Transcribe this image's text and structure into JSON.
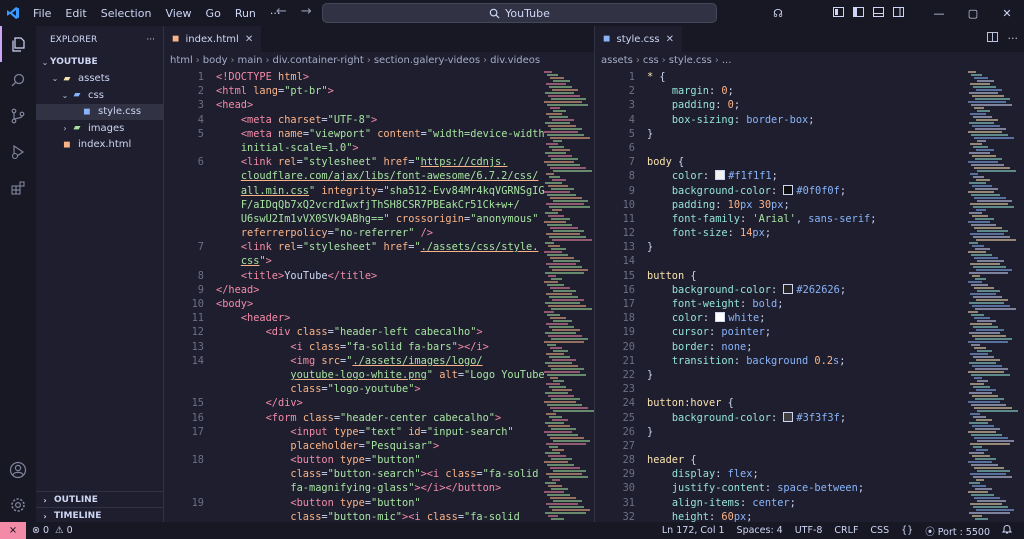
{
  "titlebar": {
    "menu": [
      "File",
      "Edit",
      "Selection",
      "View",
      "Go",
      "Run"
    ],
    "more": "···",
    "back": "←",
    "forward": "→",
    "search": "YouTube",
    "copilot": "☊",
    "window_controls": [
      "—",
      "▢",
      "✕"
    ]
  },
  "activity": {
    "items": [
      {
        "name": "explorer-icon",
        "glyph": "❐"
      },
      {
        "name": "search-icon",
        "glyph": "⌕"
      },
      {
        "name": "source-control-icon",
        "glyph": "⑂"
      },
      {
        "name": "run-debug-icon",
        "glyph": "▷"
      },
      {
        "name": "extensions-icon",
        "glyph": "⊞"
      }
    ],
    "account": "◯",
    "settings": "⚙"
  },
  "explorer": {
    "title": "EXPLORER",
    "more": "···",
    "tree": [
      {
        "label": "YOUTUBE",
        "depth": 0,
        "chev": "⌄",
        "icon": "",
        "bold": true
      },
      {
        "label": "assets",
        "depth": 1,
        "chev": "⌄",
        "icon": "▰",
        "color": "#f9e2af"
      },
      {
        "label": "css",
        "depth": 2,
        "chev": "⌄",
        "icon": "▰",
        "color": "#89b4fa"
      },
      {
        "label": "style.css",
        "depth": 3,
        "chev": "",
        "icon": "◼",
        "color": "#89b4fa",
        "selected": true
      },
      {
        "label": "images",
        "depth": 2,
        "chev": "›",
        "icon": "▰",
        "color": "#a6e3a1"
      },
      {
        "label": "index.html",
        "depth": 1,
        "chev": "",
        "icon": "◼",
        "color": "#fab387"
      }
    ],
    "outline": "OUTLINE",
    "timeline": "TIMELINE"
  },
  "left_editor": {
    "tab": "index.html",
    "breadcrumb": [
      "html",
      "body",
      "main",
      "div.container-right",
      "section.galery-videos",
      "div.videos"
    ],
    "lines": [
      {
        "n": "1",
        "h": "<span class='tg'>&lt;!DOCTYPE</span> <span class='at'>html</span><span class='tg'>&gt;</span>"
      },
      {
        "n": "2",
        "h": "<span class='tg'>&lt;html</span> <span class='at'>lang</span><span class='pu'>=</span><span class='sv'>\"pt-br\"</span><span class='tg'>&gt;</span>"
      },
      {
        "n": "3",
        "h": "<span class='tg'>&lt;head&gt;</span>"
      },
      {
        "n": "4",
        "h": "    <span class='tg'>&lt;meta</span> <span class='at'>charset</span><span class='pu'>=</span><span class='sv'>\"UTF-8\"</span><span class='tg'>&gt;</span>"
      },
      {
        "n": "5",
        "h": "    <span class='tg'>&lt;meta</span> <span class='at'>name</span><span class='pu'>=</span><span class='sv'>\"viewport\"</span> <span class='at'>content</span><span class='pu'>=</span><span class='sv'>\"width=device-width,</span>"
      },
      {
        "n": "",
        "h": "    <span class='sv'>initial-scale=1.0\"</span><span class='tg'>&gt;</span>"
      },
      {
        "n": "6",
        "h": "    <span class='tg'>&lt;link</span> <span class='at'>rel</span><span class='pu'>=</span><span class='sv'>\"stylesheet\"</span> <span class='at'>href</span><span class='pu'>=</span><span class='sv'>\"</span><span class='lk'>https://cdnjs.</span>"
      },
      {
        "n": "",
        "h": "    <span class='lk'>cloudflare.com/ajax/libs/font-awesome/6.7.2/css/</span>"
      },
      {
        "n": "",
        "h": "    <span class='lk'>all.min.css</span><span class='sv'>\"</span> <span class='at'>integrity</span><span class='pu'>=</span><span class='sv'>\"sha512-Evv84Mr4kqVGRNSgIGL/</span>"
      },
      {
        "n": "",
        "h": "    <span class='sv'>F/aIDqQb7xQ2vcrdIwxfjThSH8CSR7PBEakCr51Ck+w+/</span>"
      },
      {
        "n": "",
        "h": "    <span class='sv'>U6swU2Im1vVX0SVk9ABhg==\"</span> <span class='at'>crossorigin</span><span class='pu'>=</span><span class='sv'>\"anonymous\"</span>"
      },
      {
        "n": "",
        "h": "    <span class='at'>referrerpolicy</span><span class='pu'>=</span><span class='sv'>\"no-referrer\"</span> <span class='tg'>/&gt;</span>"
      },
      {
        "n": "7",
        "h": "    <span class='tg'>&lt;link</span> <span class='at'>rel</span><span class='pu'>=</span><span class='sv'>\"stylesheet\"</span> <span class='at'>href</span><span class='pu'>=</span><span class='sv'>\"</span><span class='lk'>./assets/css/style.</span>"
      },
      {
        "n": "",
        "h": "    <span class='lk'>css</span><span class='sv'>\"</span><span class='tg'>&gt;</span>"
      },
      {
        "n": "8",
        "h": "    <span class='tg'>&lt;title&gt;</span><span class='pl'>YouTube</span><span class='tg'>&lt;/title&gt;</span>"
      },
      {
        "n": "9",
        "h": "<span class='tg'>&lt;/head&gt;</span>"
      },
      {
        "n": "10",
        "h": "<span class='tg'>&lt;body&gt;</span>"
      },
      {
        "n": "11",
        "h": "    <span class='tg'>&lt;header&gt;</span>"
      },
      {
        "n": "12",
        "h": "        <span class='tg'>&lt;div</span> <span class='at'>class</span><span class='pu'>=</span><span class='sv'>\"header-left cabecalho\"</span><span class='tg'>&gt;</span>"
      },
      {
        "n": "13",
        "h": "            <span class='tg'>&lt;i</span> <span class='at'>class</span><span class='pu'>=</span><span class='sv'>\"fa-solid fa-bars\"</span><span class='tg'>&gt;&lt;/i&gt;</span>"
      },
      {
        "n": "14",
        "h": "            <span class='tg'>&lt;img</span> <span class='at'>src</span><span class='pu'>=</span><span class='sv'>\"</span><span class='lk'>./assets/images/logo/</span>"
      },
      {
        "n": "",
        "h": "            <span class='lk'>youtube-logo-white.png</span><span class='sv'>\"</span> <span class='at'>alt</span><span class='pu'>=</span><span class='sv'>\"Logo YouTube\"</span>"
      },
      {
        "n": "",
        "h": "            <span class='at'>class</span><span class='pu'>=</span><span class='sv'>\"logo-youtube\"</span><span class='tg'>&gt;</span>"
      },
      {
        "n": "15",
        "h": "        <span class='tg'>&lt;/div&gt;</span>"
      },
      {
        "n": "16",
        "h": "        <span class='tg'>&lt;form</span> <span class='at'>class</span><span class='pu'>=</span><span class='sv'>\"header-center cabecalho\"</span><span class='tg'>&gt;</span>"
      },
      {
        "n": "17",
        "h": "            <span class='tg'>&lt;input</span> <span class='at'>type</span><span class='pu'>=</span><span class='sv'>\"text\"</span> <span class='at'>id</span><span class='pu'>=</span><span class='sv'>\"input-search\"</span>"
      },
      {
        "n": "",
        "h": "            <span class='at'>placeholder</span><span class='pu'>=</span><span class='sv'>\"Pesquisar\"</span><span class='tg'>&gt;</span>"
      },
      {
        "n": "18",
        "h": "            <span class='tg'>&lt;button</span> <span class='at'>type</span><span class='pu'>=</span><span class='sv'>\"button\"</span>"
      },
      {
        "n": "",
        "h": "            <span class='at'>class</span><span class='pu'>=</span><span class='sv'>\"button-search\"</span><span class='tg'>&gt;&lt;i</span> <span class='at'>class</span><span class='pu'>=</span><span class='sv'>\"fa-solid</span>"
      },
      {
        "n": "",
        "h": "            <span class='sv'>fa-magnifying-glass\"</span><span class='tg'>&gt;&lt;/i&gt;&lt;/button&gt;</span>"
      },
      {
        "n": "19",
        "h": "            <span class='tg'>&lt;button</span> <span class='at'>type</span><span class='pu'>=</span><span class='sv'>\"button\"</span>"
      },
      {
        "n": "",
        "h": "            <span class='at'>class</span><span class='pu'>=</span><span class='sv'>\"button-mic\"</span><span class='tg'>&gt;&lt;i</span> <span class='at'>class</span><span class='pu'>=</span><span class='sv'>\"fa-solid</span>"
      }
    ]
  },
  "right_editor": {
    "tab": "style.css",
    "breadcrumb": [
      "assets",
      "css",
      "style.css",
      "..."
    ],
    "lines": [
      {
        "n": "1",
        "h": "<span class='sel-c'>*</span> <span class='pu'>{</span>"
      },
      {
        "n": "2",
        "h": "    <span class='pr'>margin</span><span class='pu'>:</span> <span class='nu'>0</span><span class='pu'>;</span>"
      },
      {
        "n": "3",
        "h": "    <span class='pr'>padding</span><span class='pu'>:</span> <span class='nu'>0</span><span class='pu'>;</span>"
      },
      {
        "n": "4",
        "h": "    <span class='pr'>box-sizing</span><span class='pu'>:</span> <span class='kw'>border-box</span><span class='pu'>;</span>"
      },
      {
        "n": "5",
        "h": "<span class='pu'>}</span>"
      },
      {
        "n": "6",
        "h": ""
      },
      {
        "n": "7",
        "h": "<span class='sel-c'>body</span> <span class='pu'>{</span>"
      },
      {
        "n": "8",
        "h": "    <span class='pr'>color</span><span class='pu'>:</span> <span class='sw' style='background:#f1f1f1'></span><span class='kw'>#f1f1f1</span><span class='pu'>;</span>"
      },
      {
        "n": "9",
        "h": "    <span class='pr'>background-color</span><span class='pu'>:</span> <span class='sw' style='background:#0f0f0f'></span><span class='kw'>#0f0f0f</span><span class='pu'>;</span>"
      },
      {
        "n": "10",
        "h": "    <span class='pr'>padding</span><span class='pu'>:</span> <span class='nu'>10</span><span class='kw'>px</span> <span class='nu'>30</span><span class='kw'>px</span><span class='pu'>;</span>"
      },
      {
        "n": "11",
        "h": "    <span class='pr'>font-family</span><span class='pu'>:</span> <span class='sv'>'Arial'</span><span class='pu'>,</span> <span class='kw'>sans-serif</span><span class='pu'>;</span>"
      },
      {
        "n": "12",
        "h": "    <span class='pr'>font-size</span><span class='pu'>:</span> <span class='nu'>14</span><span class='kw'>px</span><span class='pu'>;</span>"
      },
      {
        "n": "13",
        "h": "<span class='pu'>}</span>"
      },
      {
        "n": "14",
        "h": ""
      },
      {
        "n": "15",
        "h": "<span class='sel-c'>button</span> <span class='pu'>{</span>"
      },
      {
        "n": "16",
        "h": "    <span class='pr'>background-color</span><span class='pu'>:</span> <span class='sw' style='background:#262626'></span><span class='kw'>#262626</span><span class='pu'>;</span>"
      },
      {
        "n": "17",
        "h": "    <span class='pr'>font-weight</span><span class='pu'>:</span> <span class='kw'>bold</span><span class='pu'>;</span>"
      },
      {
        "n": "18",
        "h": "    <span class='pr'>color</span><span class='pu'>:</span> <span class='sw' style='background:#ffffff'></span><span class='kw'>white</span><span class='pu'>;</span>"
      },
      {
        "n": "19",
        "h": "    <span class='pr'>cursor</span><span class='pu'>:</span> <span class='kw'>pointer</span><span class='pu'>;</span>"
      },
      {
        "n": "20",
        "h": "    <span class='pr'>border</span><span class='pu'>:</span> <span class='kw'>none</span><span class='pu'>;</span>"
      },
      {
        "n": "21",
        "h": "    <span class='pr'>transition</span><span class='pu'>:</span> <span class='kw'>background</span> <span class='nu'>0.2</span><span class='kw'>s</span><span class='pu'>;</span>"
      },
      {
        "n": "22",
        "h": "<span class='pu'>}</span>"
      },
      {
        "n": "23",
        "h": ""
      },
      {
        "n": "24",
        "h": "<span class='sel-c'>button:hover</span> <span class='pu'>{</span>"
      },
      {
        "n": "25",
        "h": "    <span class='pr'>background-color</span><span class='pu'>:</span> <span class='sw' style='background:#3f3f3f'></span><span class='kw'>#3f3f3f</span><span class='pu'>;</span>"
      },
      {
        "n": "26",
        "h": "<span class='pu'>}</span>"
      },
      {
        "n": "27",
        "h": ""
      },
      {
        "n": "28",
        "h": "<span class='sel-c'>header</span> <span class='pu'>{</span>"
      },
      {
        "n": "29",
        "h": "    <span class='pr'>display</span><span class='pu'>:</span> <span class='kw'>flex</span><span class='pu'>;</span>"
      },
      {
        "n": "30",
        "h": "    <span class='pr'>justify-content</span><span class='pu'>:</span> <span class='kw'>space-between</span><span class='pu'>;</span>"
      },
      {
        "n": "31",
        "h": "    <span class='pr'>align-items</span><span class='pu'>:</span> <span class='kw'>center</span><span class='pu'>;</span>"
      },
      {
        "n": "32",
        "h": "    <span class='pr'>height</span><span class='pu'>:</span> <span class='nu'>60</span><span class='kw'>px</span><span class='pu'>;</span>"
      }
    ]
  },
  "statusbar": {
    "remote": "⨯",
    "errors": "⊗ 0",
    "warnings": "⚠ 0",
    "cursor": "Ln 172, Col 1",
    "spaces": "Spaces: 4",
    "encoding": "UTF-8",
    "eol": "CRLF",
    "language": "CSS",
    "port": "⦿ Port : 5500",
    "bell": "🔔"
  }
}
